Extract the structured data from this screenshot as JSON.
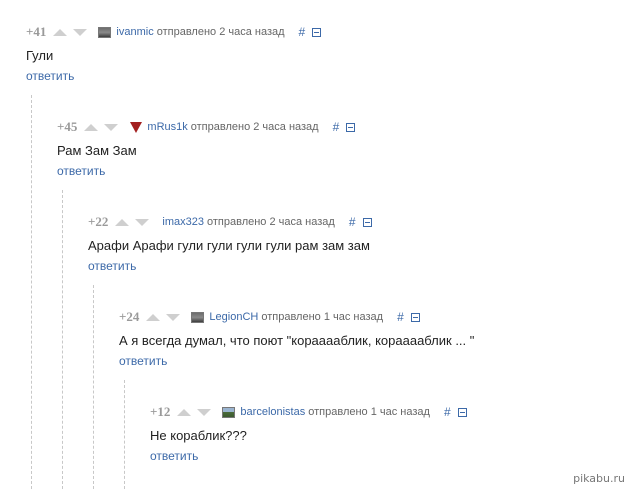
{
  "comments": [
    {
      "rating": "+41",
      "author": "ivanmic",
      "sent": "отправлено 2 часа назад",
      "hash": "#",
      "text": "Гули",
      "reply": "ответить"
    },
    {
      "rating": "+45",
      "author": "mRus1k",
      "sent": "отправлено 2 часа назад",
      "hash": "#",
      "text": "Рам Зам Зам",
      "reply": "ответить"
    },
    {
      "rating": "+22",
      "author": "imax323",
      "sent": "отправлено 2 часа назад",
      "hash": "#",
      "text": "Арафи Арафи гули гули гули гули рам зам зам",
      "reply": "ответить"
    },
    {
      "rating": "+24",
      "author": "LegionCH",
      "sent": "отправлено 1 час назад",
      "hash": "#",
      "text": "А я всегда думал, что поют \"корааааблик, корааааблик ... \"",
      "reply": "ответить"
    },
    {
      "rating": "+12",
      "author": "barcelonistas",
      "sent": "отправлено 1 час назад",
      "hash": "#",
      "text": "Не кораблик???",
      "reply": "ответить"
    }
  ],
  "watermark": "pikabu.ru"
}
